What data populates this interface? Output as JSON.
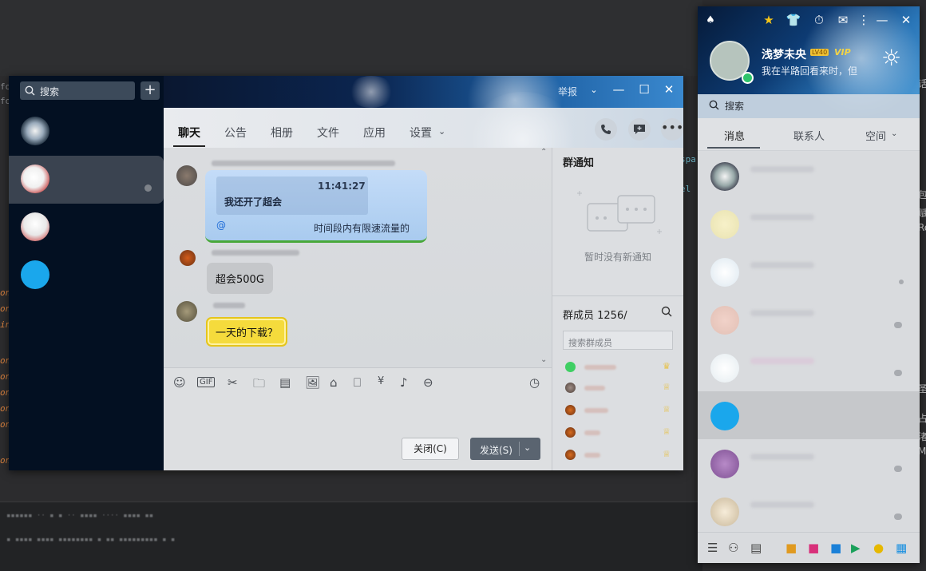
{
  "chat_window": {
    "search_placeholder": "搜索",
    "add_label": "+",
    "report_label": "举报",
    "tabs": [
      {
        "label": "聊天"
      },
      {
        "label": "公告"
      },
      {
        "label": "相册"
      },
      {
        "label": "文件"
      },
      {
        "label": "应用"
      },
      {
        "label": "设置"
      }
    ],
    "messages": {
      "quote_time": "11:41:27",
      "quote_text": "我还开了超会",
      "at_symbol": "@",
      "reply_text": "时间段内有限速流量的",
      "msg2": "超会500G",
      "msg3": "一天的下载？"
    },
    "buttons": {
      "close": "关闭(C)",
      "send": "发送(S)"
    },
    "right_pane": {
      "notice_title": "群通知",
      "notice_empty": "暂时没有新通知",
      "members_title": "群成员 1256/",
      "member_search_placeholder": "搜索群成员"
    }
  },
  "qq_main": {
    "user_name": "浅梦未央",
    "level_badge": "LV40",
    "vip_label": "VIP",
    "signature": "我在半路回看来时，但",
    "search_placeholder": "搜索",
    "tabs": [
      {
        "label": "消息"
      },
      {
        "label": "联系人"
      },
      {
        "label": "空间"
      }
    ]
  },
  "colors": {
    "accent_blue": "#1d6bd8",
    "chat_sidebar": "#031022",
    "online": "#2fc46b",
    "send_button": "#5a6470"
  }
}
